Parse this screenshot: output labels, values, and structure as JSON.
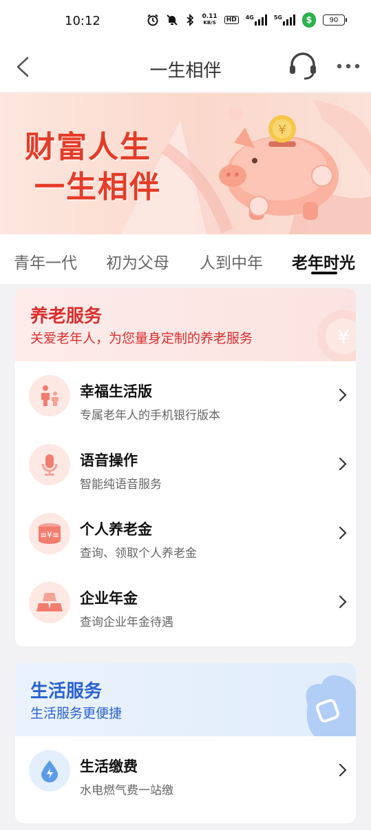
{
  "status_bar": {
    "time": "10:12",
    "net_speed_value": "0.11",
    "net_speed_unit": "KB/S",
    "hd": "HD",
    "sig1": "4G",
    "sig2": "5G",
    "battery": "90",
    "icons": [
      "alarm-icon",
      "mute-icon",
      "bluetooth-icon",
      "signal-icon",
      "shield-icon",
      "battery-icon"
    ]
  },
  "nav": {
    "title": "一生相伴",
    "icons": [
      "back-icon",
      "customer-service-icon",
      "more-icon"
    ]
  },
  "banner": {
    "line1": "财富人生",
    "line2": "一生相伴",
    "colors": {
      "text": "#e43c28",
      "bg": "#fbd8cc"
    }
  },
  "tabs": [
    {
      "label": "青年一代",
      "active": false
    },
    {
      "label": "初为父母",
      "active": false
    },
    {
      "label": "人到中年",
      "active": false
    },
    {
      "label": "老年时光",
      "active": true
    }
  ],
  "pension_section": {
    "title": "养老服务",
    "subtitle": "关爱老年人，为您量身定制的养老服务",
    "accent": "#d9302f",
    "items": [
      {
        "title": "幸福生活版",
        "subtitle": "专属老年人的手机银行版本",
        "icon": "family-icon"
      },
      {
        "title": "语音操作",
        "subtitle": "智能纯语音服务",
        "icon": "microphone-icon"
      },
      {
        "title": "个人养老金",
        "subtitle": "查询、领取个人养老金",
        "icon": "coin-stack-icon"
      },
      {
        "title": "企业年金",
        "subtitle": "查询企业年金待遇",
        "icon": "gold-bars-icon"
      }
    ]
  },
  "life_section": {
    "title": "生活服务",
    "subtitle": "生活服务更便捷",
    "accent": "#2a62d0",
    "items": [
      {
        "title": "生活缴费",
        "subtitle": "水电燃气费一站缴",
        "icon": "water-drop-icon"
      }
    ]
  }
}
